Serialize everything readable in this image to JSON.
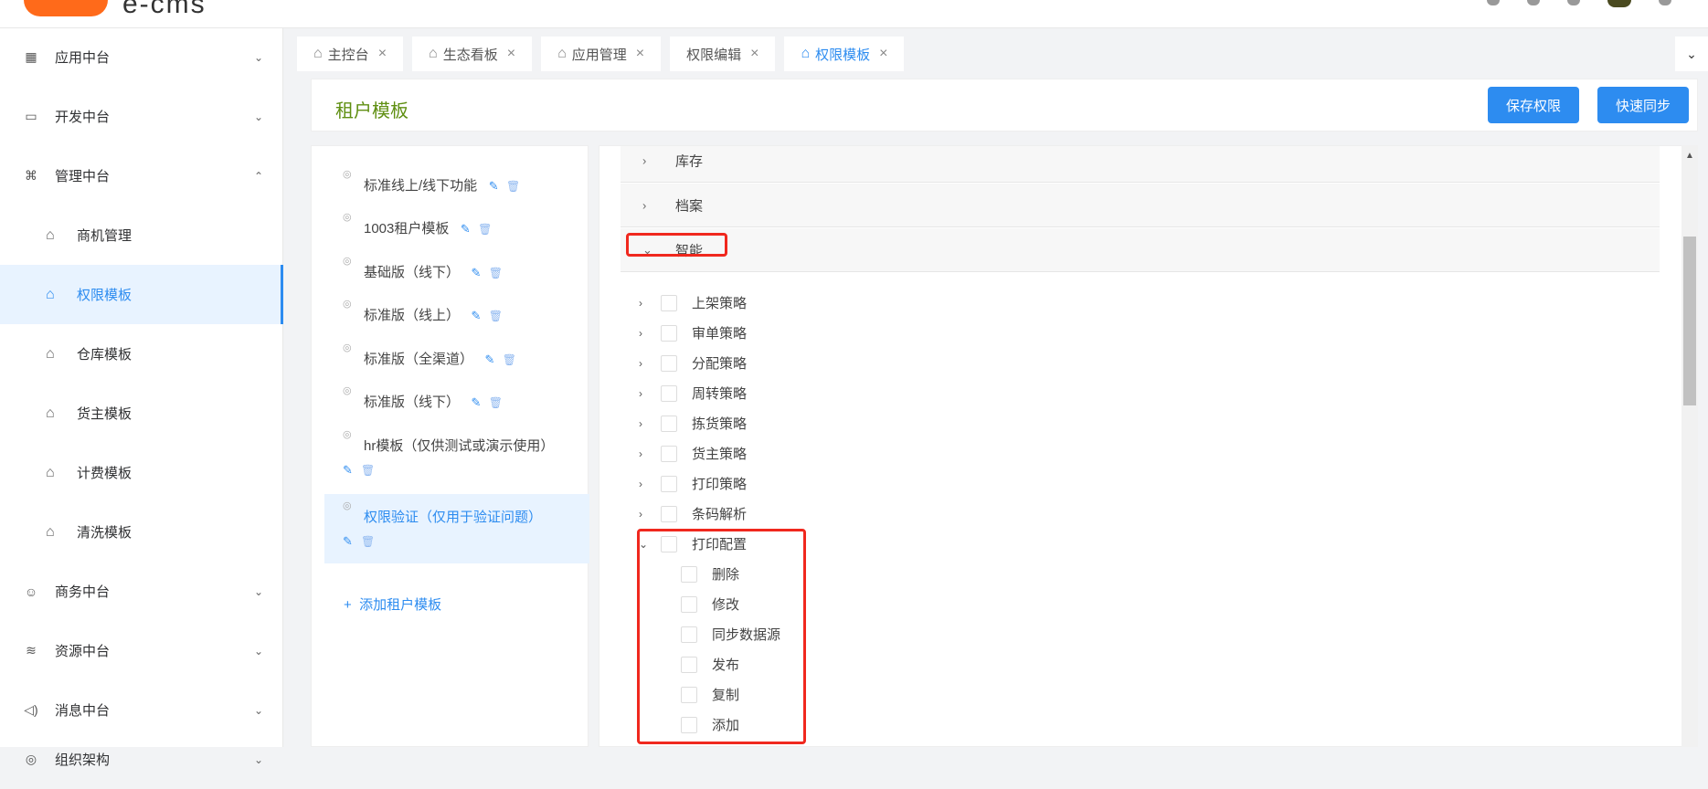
{
  "app": {
    "logo_text": "e-cms"
  },
  "sidebar": {
    "menu": [
      {
        "label": "应用中台",
        "chevron": "⌄"
      },
      {
        "label": "开发中台",
        "chevron": "⌄"
      },
      {
        "label": "管理中台",
        "chevron": "⌃"
      },
      {
        "label": "商务中台",
        "chevron": "⌄"
      },
      {
        "label": "资源中台",
        "chevron": "⌄"
      },
      {
        "label": "消息中台",
        "chevron": "⌄"
      },
      {
        "label": "组织架构",
        "chevron": "⌄"
      }
    ],
    "submenu": [
      {
        "label": "商机管理"
      },
      {
        "label": "权限模板"
      },
      {
        "label": "仓库模板"
      },
      {
        "label": "货主模板"
      },
      {
        "label": "计费模板"
      },
      {
        "label": "清洗模板"
      }
    ]
  },
  "tabs": [
    {
      "label": "主控台"
    },
    {
      "label": "生态看板"
    },
    {
      "label": "应用管理"
    },
    {
      "label": "权限编辑"
    },
    {
      "label": "权限模板"
    }
  ],
  "header": {
    "title": "租户模板",
    "save_label": "保存权限",
    "sync_label": "快速同步"
  },
  "templates": {
    "items": [
      {
        "name": "标准线上/线下功能"
      },
      {
        "name": "1003租户模板"
      },
      {
        "name": "基础版（线下）"
      },
      {
        "name": "标准版（线上）"
      },
      {
        "name": "标准版（全渠道）"
      },
      {
        "name": "标准版（线下）"
      },
      {
        "name": "hr模板（仅供测试或演示使用）"
      },
      {
        "name": "权限验证（仅用于验证问题）"
      }
    ],
    "add_label": "添加租户模板"
  },
  "permissions": {
    "categories": [
      {
        "label": "库存"
      },
      {
        "label": "档案"
      },
      {
        "label": "智能"
      }
    ],
    "tree": [
      {
        "label": "上架策略"
      },
      {
        "label": "审单策略"
      },
      {
        "label": "分配策略"
      },
      {
        "label": "周转策略"
      },
      {
        "label": "拣货策略"
      },
      {
        "label": "货主策略"
      },
      {
        "label": "打印策略"
      },
      {
        "label": "条码解析"
      },
      {
        "label": "打印配置"
      }
    ],
    "children": [
      {
        "label": "删除"
      },
      {
        "label": "修改"
      },
      {
        "label": "同步数据源"
      },
      {
        "label": "发布"
      },
      {
        "label": "复制"
      },
      {
        "label": "添加"
      }
    ]
  },
  "colors": {
    "accent": "#2d8cf0",
    "title_green": "#5f8f12",
    "highlight_red": "#f0281e",
    "logo_orange": "#ff6a1a"
  }
}
